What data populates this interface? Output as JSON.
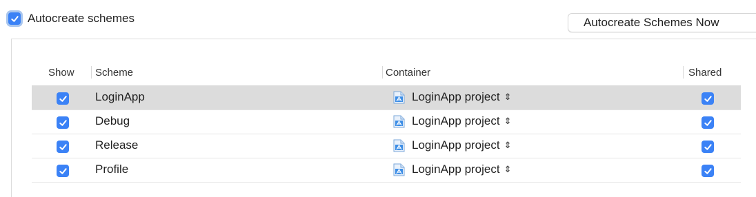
{
  "autocreate": {
    "label": "Autocreate schemes",
    "checked": true
  },
  "autocreate_now_button": "Autocreate Schemes Now",
  "table": {
    "columns": {
      "show": "Show",
      "scheme": "Scheme",
      "container": "Container",
      "shared": "Shared"
    },
    "rows": [
      {
        "show": true,
        "scheme": "LoginApp",
        "container": "LoginApp project",
        "shared": true,
        "selected": true
      },
      {
        "show": true,
        "scheme": "Debug",
        "container": "LoginApp project",
        "shared": true,
        "selected": false
      },
      {
        "show": true,
        "scheme": "Release",
        "container": "LoginApp project",
        "shared": true,
        "selected": false
      },
      {
        "show": true,
        "scheme": "Profile",
        "container": "LoginApp project",
        "shared": true,
        "selected": false
      }
    ]
  },
  "colors": {
    "accent": "#3b82f6",
    "selected_row": "#dcdcdc",
    "focus_ring": "#a9c6ee"
  },
  "icons": {
    "checkbox": "checkmark-icon",
    "container": "xcode-project-icon",
    "popup": "up-down-chevron-icon"
  }
}
